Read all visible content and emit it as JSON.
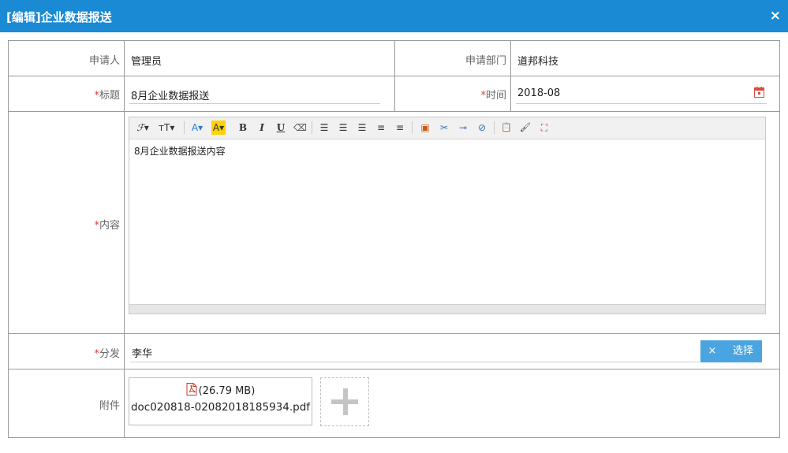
{
  "window": {
    "title": "[编辑]企业数据报送",
    "close_glyph": "×"
  },
  "form": {
    "applicant": {
      "label": "申请人",
      "value": "管理员"
    },
    "department": {
      "label": "申请部门",
      "value": "道邦科技"
    },
    "subject": {
      "required": "*",
      "label": "标题",
      "value": "8月企业数据报送"
    },
    "time": {
      "required": "*",
      "label": "时间",
      "value": "2018-08",
      "icon": "calendar-icon"
    },
    "content": {
      "required": "*",
      "label": "内容",
      "value": "8月企业数据报送内容",
      "toolbar": {
        "font_family": "ℱ▾",
        "font_size": "тT▾",
        "font_color": "A▾",
        "highlight": "A▾",
        "bold": "B",
        "italic": "I",
        "underline": "U",
        "eraser": "⌫",
        "align_left": "☰",
        "align_center": "☰",
        "align_right": "☰",
        "ordered_list": "≡",
        "unordered_list": "≡",
        "insert_image": "▣",
        "cut": "✂",
        "link": "⊸",
        "unlink": "⊘",
        "paste": "📋",
        "format_painter": "🖌",
        "fullscreen": "⛶"
      }
    },
    "distribution": {
      "required": "*",
      "label": "分发",
      "value": "李华",
      "clear_label": "×",
      "select_label": "选择"
    },
    "attachment": {
      "label": "附件",
      "file_size": "(26.79 MB)",
      "file_name": "doc020818-02082018185934.pdf",
      "file_icon": "pdf-icon"
    }
  },
  "colors": {
    "header_bg": "#1a8ad4",
    "required": "#e4393c",
    "button_bg": "#4aa4e0"
  }
}
